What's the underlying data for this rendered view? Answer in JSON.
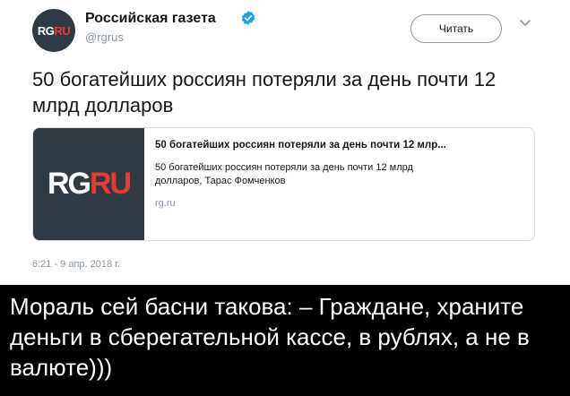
{
  "author": {
    "name": "Российская газета",
    "handle": "@rgrus",
    "avatar_logo": {
      "part1": "RG",
      "part2": "RU"
    }
  },
  "follow_label": "Читать",
  "tweet_text": "50 богатейших россиян потеряли за день почти 12 млрд долларов",
  "card": {
    "image_logo": {
      "part1": "RG",
      "part2": "RU"
    },
    "title": "50 богатейших россиян потеряли за день почти 12 млр...",
    "description": "50 богатейших россиян потеряли за день почти 12 млрд долларов, Тарас Фомченков",
    "domain": "rg.ru"
  },
  "timestamp": "6:21 - 9 апр. 2018 г.",
  "caption": "Мораль сей басни такова: – Граждане, храните деньги в сберегательной кассе, в рублях, а не в валюте)))",
  "colors": {
    "brand_dark": "#2f3a45",
    "brand_red": "#e63b2e",
    "verified_blue": "#1da1f2",
    "muted_text": "#8a96a3"
  },
  "icons": [
    "verified-badge-icon",
    "chevron-down-icon"
  ]
}
